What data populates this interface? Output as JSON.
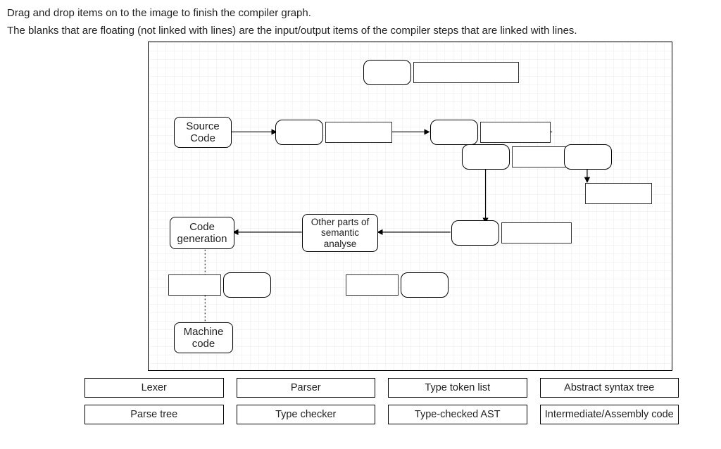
{
  "instructions": {
    "line1": "Drag and drop items on to the image to finish the compiler graph.",
    "line2": "The blanks that are floating (not linked with lines) are the input/output items of the compiler steps that are linked with lines."
  },
  "nodes": {
    "source_code": "Source\nCode",
    "code_generation": "Code\ngeneration",
    "other_semantic": "Other parts of\nsemantic\nanalyse",
    "machine_code": "Machine\ncode"
  },
  "bank": {
    "row1": {
      "a": "Lexer",
      "b": "Parser",
      "c": "Type token list",
      "d": "Abstract syntax tree"
    },
    "row2": {
      "a": "Parse tree",
      "b": "Type checker",
      "c": "Type-checked AST",
      "d": "Intermediate/Assembly code"
    }
  }
}
